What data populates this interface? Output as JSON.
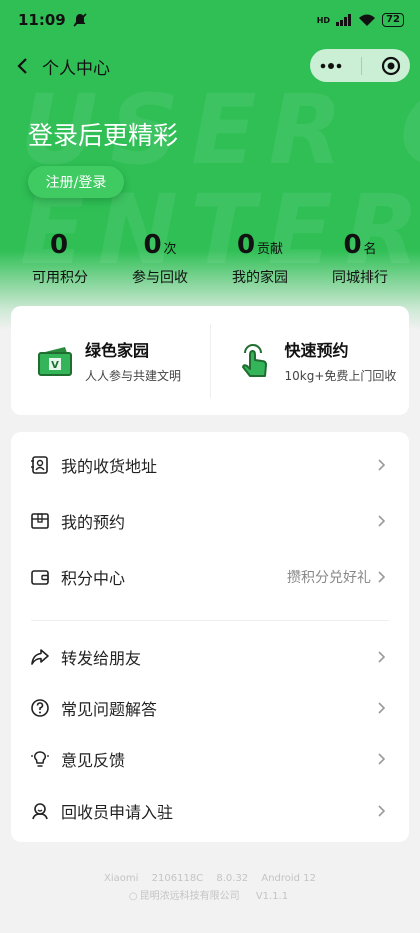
{
  "status": {
    "time": "11:09",
    "signal": "HD",
    "battery": "72"
  },
  "nav": {
    "title": "个人中心"
  },
  "watermark": {
    "line1": "USER C",
    "line2": "ENTER"
  },
  "profile": {
    "login_title": "登录后更精彩",
    "register_label": "注册/登录"
  },
  "stats": [
    {
      "value": "0",
      "unit": "",
      "label": "可用积分"
    },
    {
      "value": "0",
      "unit": "次",
      "label": "参与回收"
    },
    {
      "value": "0",
      "unit": "贡献",
      "label": "我的家园"
    },
    {
      "value": "0",
      "unit": "名",
      "label": "同城排行"
    }
  ],
  "quick": [
    {
      "title": "绿色家园",
      "sub": "人人参与共建文明",
      "icon": "wallet-icon"
    },
    {
      "title": "快速预约",
      "sub": "10kg+免费上门回收",
      "icon": "tap-hand-icon"
    }
  ],
  "menu": [
    {
      "label": "我的收货地址",
      "extra": "",
      "icon": "address-icon"
    },
    {
      "label": "我的预约",
      "extra": "",
      "icon": "box-icon"
    },
    {
      "label": "积分中心",
      "extra": "攒积分兑好礼",
      "icon": "wallet-icon"
    },
    {
      "label": "转发给朋友",
      "extra": "",
      "icon": "share-icon"
    },
    {
      "label": "常见问题解答",
      "extra": "",
      "icon": "question-icon"
    },
    {
      "label": "意见反馈",
      "extra": "",
      "icon": "bulb-icon"
    },
    {
      "label": "回收员申请入驻",
      "extra": "",
      "icon": "user-icon"
    }
  ],
  "footer": {
    "device": "Xiaomi",
    "model": "2106118C",
    "wechat_version": "8.0.32",
    "os": "Android 12",
    "company": "昆明浓远科技有限公司",
    "app_version": "V1.1.1"
  },
  "colors": {
    "brand_green": "#2fbf55",
    "button_green": "#3fca62"
  }
}
